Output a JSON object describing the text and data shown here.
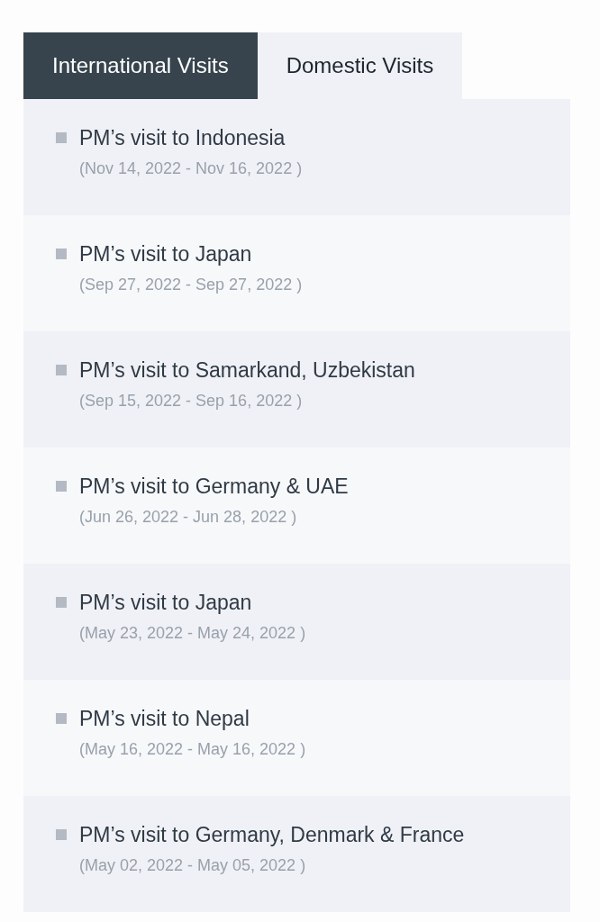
{
  "tabs": [
    {
      "label": "International Visits",
      "selected": true
    },
    {
      "label": "Domestic Visits",
      "selected": false
    }
  ],
  "visits": [
    {
      "title": "PM’s visit to Indonesia",
      "dates": "(Nov 14, 2022 - Nov 16, 2022 )"
    },
    {
      "title": "PM’s visit to Japan",
      "dates": "(Sep 27, 2022 - Sep 27, 2022 )"
    },
    {
      "title": "PM’s visit to Samarkand, Uzbekistan",
      "dates": "(Sep 15, 2022 - Sep 16, 2022 )"
    },
    {
      "title": "PM’s visit to Germany & UAE",
      "dates": "(Jun 26, 2022 - Jun 28, 2022 )"
    },
    {
      "title": "PM’s visit to Japan",
      "dates": "(May 23, 2022 - May 24, 2022 )"
    },
    {
      "title": "PM’s visit to Nepal",
      "dates": "(May 16, 2022 - May 16, 2022 )"
    },
    {
      "title": "PM’s visit to Germany, Denmark & France",
      "dates": "(May 02, 2022 - May 05, 2022 )"
    }
  ]
}
